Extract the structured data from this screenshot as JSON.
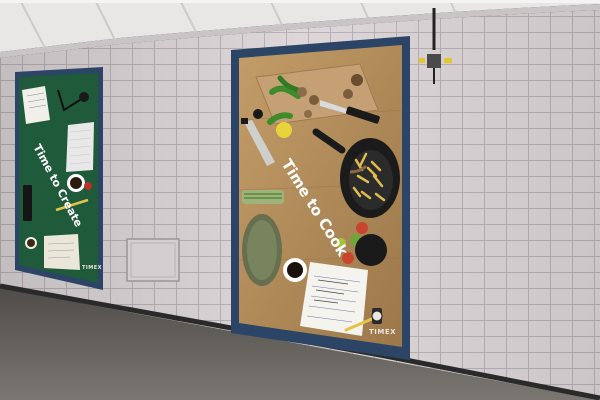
{
  "scene": {
    "description_kind": "photo of subway station wall with two advertising posters",
    "colors": {
      "tile": "#ddd7d9",
      "grout": "#b9b2b6",
      "frame": "#2c4566",
      "floor": "#6d6a66",
      "green_felt": "#1f5a3a",
      "wood": "#b08a59",
      "ceiling": "#e7e3e3",
      "caution_yellow": "#e6c62a"
    }
  },
  "posters": [
    {
      "tagline": "Time to Create",
      "brand": "TIMEX",
      "icons": [
        "notebook-icon",
        "keyboard-icon",
        "coffee-cup-icon",
        "phone-icon",
        "pencil-icon"
      ]
    },
    {
      "tagline": "Time to Cook",
      "brand": "TIMEX",
      "icons": [
        "cutting-board-icon",
        "knife-icon",
        "peppers-icon",
        "mushroom-icon",
        "lemon-icon",
        "oil-bottle-icon",
        "pasta-pan-icon",
        "coffee-cup-icon",
        "notepad-icon",
        "watch-icon"
      ]
    }
  ]
}
